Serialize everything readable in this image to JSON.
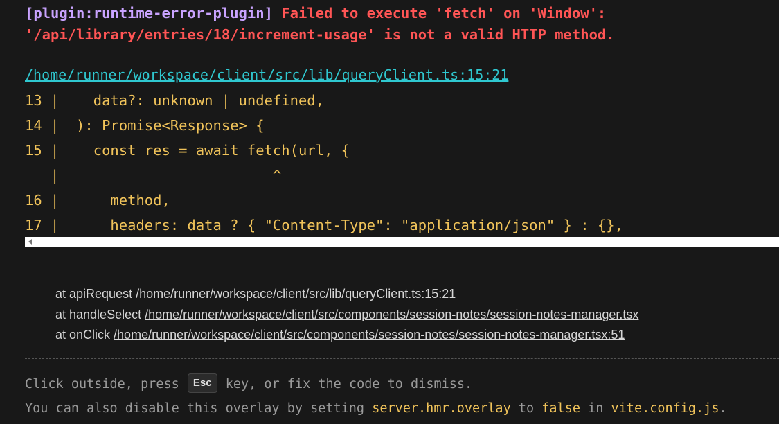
{
  "error": {
    "plugin": "[plugin:runtime-error-plugin]",
    "message_line1": "Failed to execute 'fetch' on 'Window':",
    "message_line2": "'/api/library/entries/18/increment-usage' is not a valid HTTP method."
  },
  "file_link": "/home/runner/workspace/client/src/lib/queryClient.ts:15:21",
  "code_frame": [
    "13 |    data?: unknown | undefined,",
    "14 |  ): Promise<Response> {",
    "15 |    const res = await fetch(url, {",
    "   |                         ^",
    "16 |      method,",
    "17 |      headers: data ? { \"Content-Type\": \"application/json\" } : {},"
  ],
  "stack": [
    {
      "prefix": "at apiRequest ",
      "link": "/home/runner/workspace/client/src/lib/queryClient.ts:15:21"
    },
    {
      "prefix": "at handleSelect ",
      "link": "/home/runner/workspace/client/src/components/session-notes/session-notes-manager.tsx"
    },
    {
      "prefix": "at onClick ",
      "link": "/home/runner/workspace/client/src/components/session-notes/session-notes-manager.tsx:51"
    }
  ],
  "tip": {
    "line1_before": "Click outside, press ",
    "key": "Esc",
    "line1_after": " key, or fix the code to dismiss.",
    "line2_a": "You can also disable this overlay by setting ",
    "line2_setting": "server.hmr.overlay",
    "line2_b": " to ",
    "line2_value": "false",
    "line2_c": " in ",
    "line2_file": "vite.config.js",
    "line2_d": "."
  },
  "colors": {
    "background": "#181818",
    "plugin": "#c9a3ff",
    "error": "#ff5555",
    "link": "#2fc8d0",
    "code": "#f0c35a"
  }
}
